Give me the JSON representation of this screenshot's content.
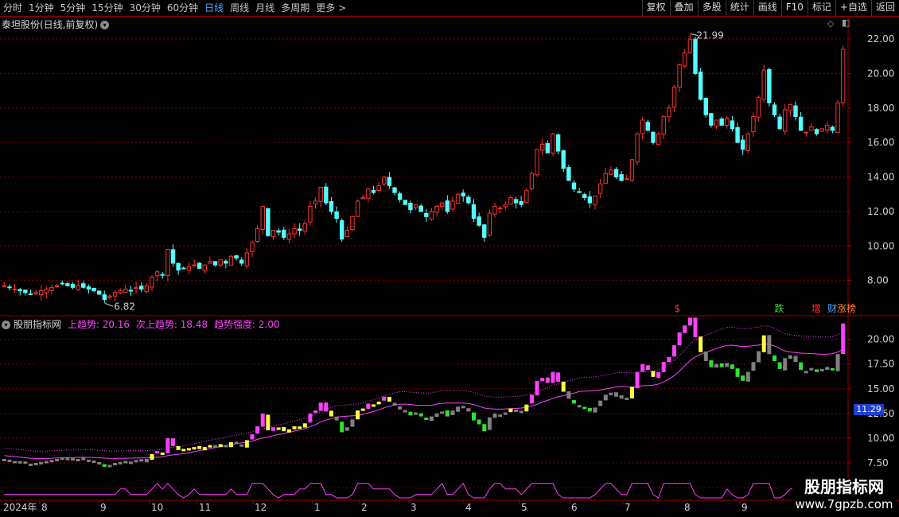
{
  "toolbar": {
    "tabs": [
      "分时",
      "1分钟",
      "5分钟",
      "15分钟",
      "30分钟",
      "60分钟",
      "日线",
      "周线",
      "月线",
      "多周期",
      "更多 >"
    ],
    "active_tab": 6,
    "buttons": [
      "复权",
      "叠加",
      "多股",
      "统计",
      "画线",
      "F10",
      "标记",
      "+自选",
      "返回"
    ]
  },
  "main_panel": {
    "title": "泰坦股份(日线,前复权)",
    "title_icon": "chevron-down-icon",
    "y_ticks": [
      "22.00",
      "20.00",
      "18.00",
      "16.00",
      "14.00",
      "12.00",
      "10.00",
      "8.00"
    ],
    "high_label": "21.99",
    "low_label": "6.82",
    "event_markers": [
      {
        "text": "$",
        "color": "#ff3030"
      },
      {
        "text": "跌",
        "color": "#3ad83a"
      },
      {
        "text": "增",
        "color": "#ff3030"
      },
      {
        "text": "财",
        "color": "#4fa8ff"
      },
      {
        "text": "涨榜",
        "color": "#ff8030"
      }
    ]
  },
  "indicator_panel": {
    "title": "股朋指标网",
    "params": [
      {
        "label": "上趋势: 20.16",
        "color": "#ff40ff"
      },
      {
        "label": "次上趋势: 18.48",
        "color": "#ff40ff"
      },
      {
        "label": "趋势强度: 2.00",
        "color": "#ff40ff"
      }
    ],
    "y_ticks": [
      "20.00",
      "17.50",
      "15.00",
      "12.50",
      "10.00",
      "7.50",
      "5.00"
    ],
    "current_price_tag": "11.29"
  },
  "x_axis": {
    "labels": [
      "2024年",
      "8",
      "9",
      "10",
      "11",
      "12",
      "1",
      "2",
      "3",
      "4",
      "5",
      "6",
      "7",
      "8",
      "9"
    ]
  },
  "watermark": {
    "line1": "股朋指标网",
    "line2": "www.7gpzb.com"
  },
  "colors": {
    "up": "#ff3232",
    "down": "#54ffff",
    "grid": "#7a0000",
    "border": "#a00000",
    "magenta": "#ff40ff",
    "yellow": "#ffff40",
    "green": "#30e030",
    "gray": "#808080"
  },
  "chart_data": {
    "type": "candlestick",
    "main_ylim": [
      6.0,
      22.6
    ],
    "ind_ylim": [
      3.8,
      22.3
    ],
    "closes": [
      7.7,
      7.6,
      7.5,
      7.4,
      7.3,
      7.2,
      7.3,
      7.4,
      7.5,
      7.6,
      7.7,
      7.8,
      7.7,
      7.6,
      7.7,
      7.6,
      7.5,
      7.4,
      7.2,
      6.9,
      7.1,
      7.3,
      7.4,
      7.5,
      7.4,
      7.6,
      7.5,
      7.7,
      8.2,
      8.5,
      8.3,
      9.8,
      9.0,
      8.6,
      8.7,
      8.8,
      8.9,
      8.7,
      8.9,
      9.1,
      8.9,
      9.2,
      9.0,
      9.4,
      9.3,
      9.0,
      9.6,
      10.2,
      11.0,
      12.3,
      10.6,
      10.9,
      10.8,
      10.5,
      10.7,
      11.0,
      10.9,
      11.3,
      12.3,
      12.6,
      13.4,
      12.5,
      12.0,
      11.6,
      10.4,
      10.9,
      11.7,
      12.6,
      12.8,
      13.3,
      13.1,
      13.5,
      14.0,
      13.5,
      13.1,
      12.7,
      12.4,
      12.1,
      12.4,
      12.0,
      11.7,
      12.0,
      12.3,
      12.5,
      12.0,
      12.6,
      13.0,
      12.9,
      12.5,
      11.6,
      11.2,
      10.5,
      11.9,
      12.3,
      12.2,
      12.4,
      12.8,
      12.5,
      12.4,
      13.2,
      14.2,
      15.6,
      15.9,
      15.4,
      16.5,
      15.5,
      14.5,
      13.8,
      13.3,
      13.1,
      12.8,
      12.5,
      12.9,
      13.6,
      14.2,
      14.4,
      14.0,
      13.8,
      13.9,
      15.0,
      16.5,
      17.3,
      16.7,
      16.0,
      16.5,
      17.5,
      18.0,
      19.2,
      20.5,
      21.2,
      21.99,
      20.0,
      18.5,
      17.6,
      17.0,
      17.3,
      17.0,
      17.4,
      16.8,
      16.0,
      15.6,
      16.5,
      17.5,
      18.6,
      20.2,
      18.3,
      17.6,
      16.8,
      17.9,
      18.2,
      17.5,
      16.7,
      16.6,
      16.9,
      16.5,
      16.8,
      17.0,
      16.7,
      18.3,
      21.4
    ],
    "x_labels": [
      "2024年",
      "8",
      "9",
      "10",
      "11",
      "12",
      "1",
      "2",
      "3",
      "4",
      "5",
      "6",
      "7",
      "8",
      "9"
    ],
    "series": [
      {
        "name": "上趋势",
        "last": 20.16
      },
      {
        "name": "次上趋势",
        "last": 18.48
      },
      {
        "name": "趋势强度",
        "last": 2.0
      }
    ]
  }
}
